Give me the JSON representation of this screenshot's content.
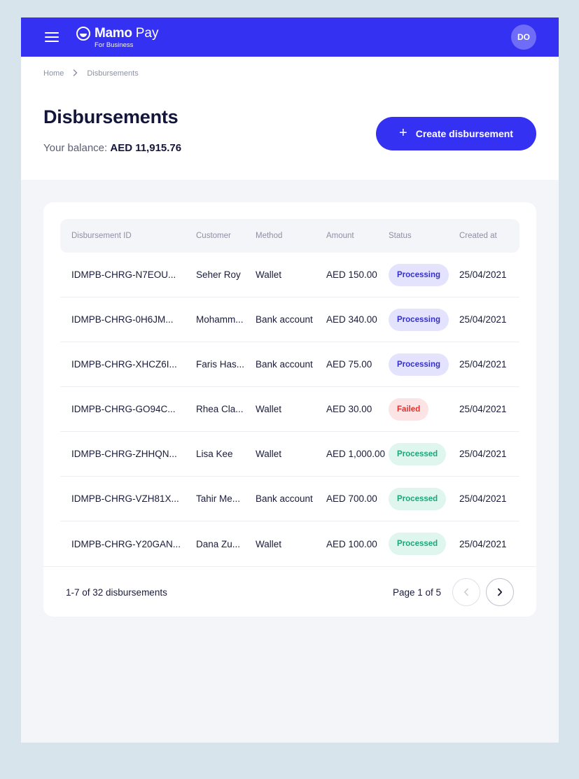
{
  "brand": {
    "name": "Mamo",
    "name2": "Pay",
    "sub": "For Business"
  },
  "user": {
    "initials": "DO"
  },
  "breadcrumb": {
    "home": "Home",
    "current": "Disbursements"
  },
  "page": {
    "title": "Disbursements",
    "balance_label": "Your balance:",
    "balance_value": "AED 11,915.76",
    "create_label": "Create disbursement"
  },
  "table": {
    "headers": [
      "Disbursement ID",
      "Customer",
      "Method",
      "Amount",
      "Status",
      "Created at"
    ],
    "rows": [
      {
        "id": "IDMPB-CHRG-N7EOU...",
        "customer": "Seher Roy",
        "method": "Wallet",
        "amount": "AED 150.00",
        "status": "Processing",
        "status_type": "processing",
        "created": "25/04/2021"
      },
      {
        "id": "IDMPB-CHRG-0H6JM...",
        "customer": "Mohamm...",
        "method": "Bank account",
        "amount": "AED 340.00",
        "status": "Processing",
        "status_type": "processing",
        "created": "25/04/2021"
      },
      {
        "id": "IDMPB-CHRG-XHCZ6I...",
        "customer": "Faris Has...",
        "method": "Bank account",
        "amount": "AED 75.00",
        "status": "Processing",
        "status_type": "processing",
        "created": "25/04/2021"
      },
      {
        "id": "IDMPB-CHRG-GO94C...",
        "customer": "Rhea Cla...",
        "method": "Wallet",
        "amount": "AED 30.00",
        "status": "Failed",
        "status_type": "failed",
        "created": "25/04/2021"
      },
      {
        "id": "IDMPB-CHRG-ZHHQN...",
        "customer": "Lisa Kee",
        "method": "Wallet",
        "amount": "AED 1,000.00",
        "status": "Processed",
        "status_type": "processed",
        "created": "25/04/2021"
      },
      {
        "id": "IDMPB-CHRG-VZH81X...",
        "customer": "Tahir Me...",
        "method": "Bank account",
        "amount": "AED 700.00",
        "status": "Processed",
        "status_type": "processed",
        "created": "25/04/2021"
      },
      {
        "id": "IDMPB-CHRG-Y20GAN...",
        "customer": "Dana Zu...",
        "method": "Wallet",
        "amount": "AED 100.00",
        "status": "Processed",
        "status_type": "processed",
        "created": "25/04/2021"
      }
    ]
  },
  "footer": {
    "count_text": "1-7 of 32 disbursements",
    "page_text": "Page 1 of 5"
  },
  "colors": {
    "brand": "#3431f3",
    "processing": "#3431c8",
    "failed": "#e0332f",
    "processed": "#1ea677"
  },
  "icons": [
    "menu-icon",
    "mamo-logo-icon",
    "chevron-right-icon",
    "plus-icon",
    "chevron-left-icon"
  ]
}
